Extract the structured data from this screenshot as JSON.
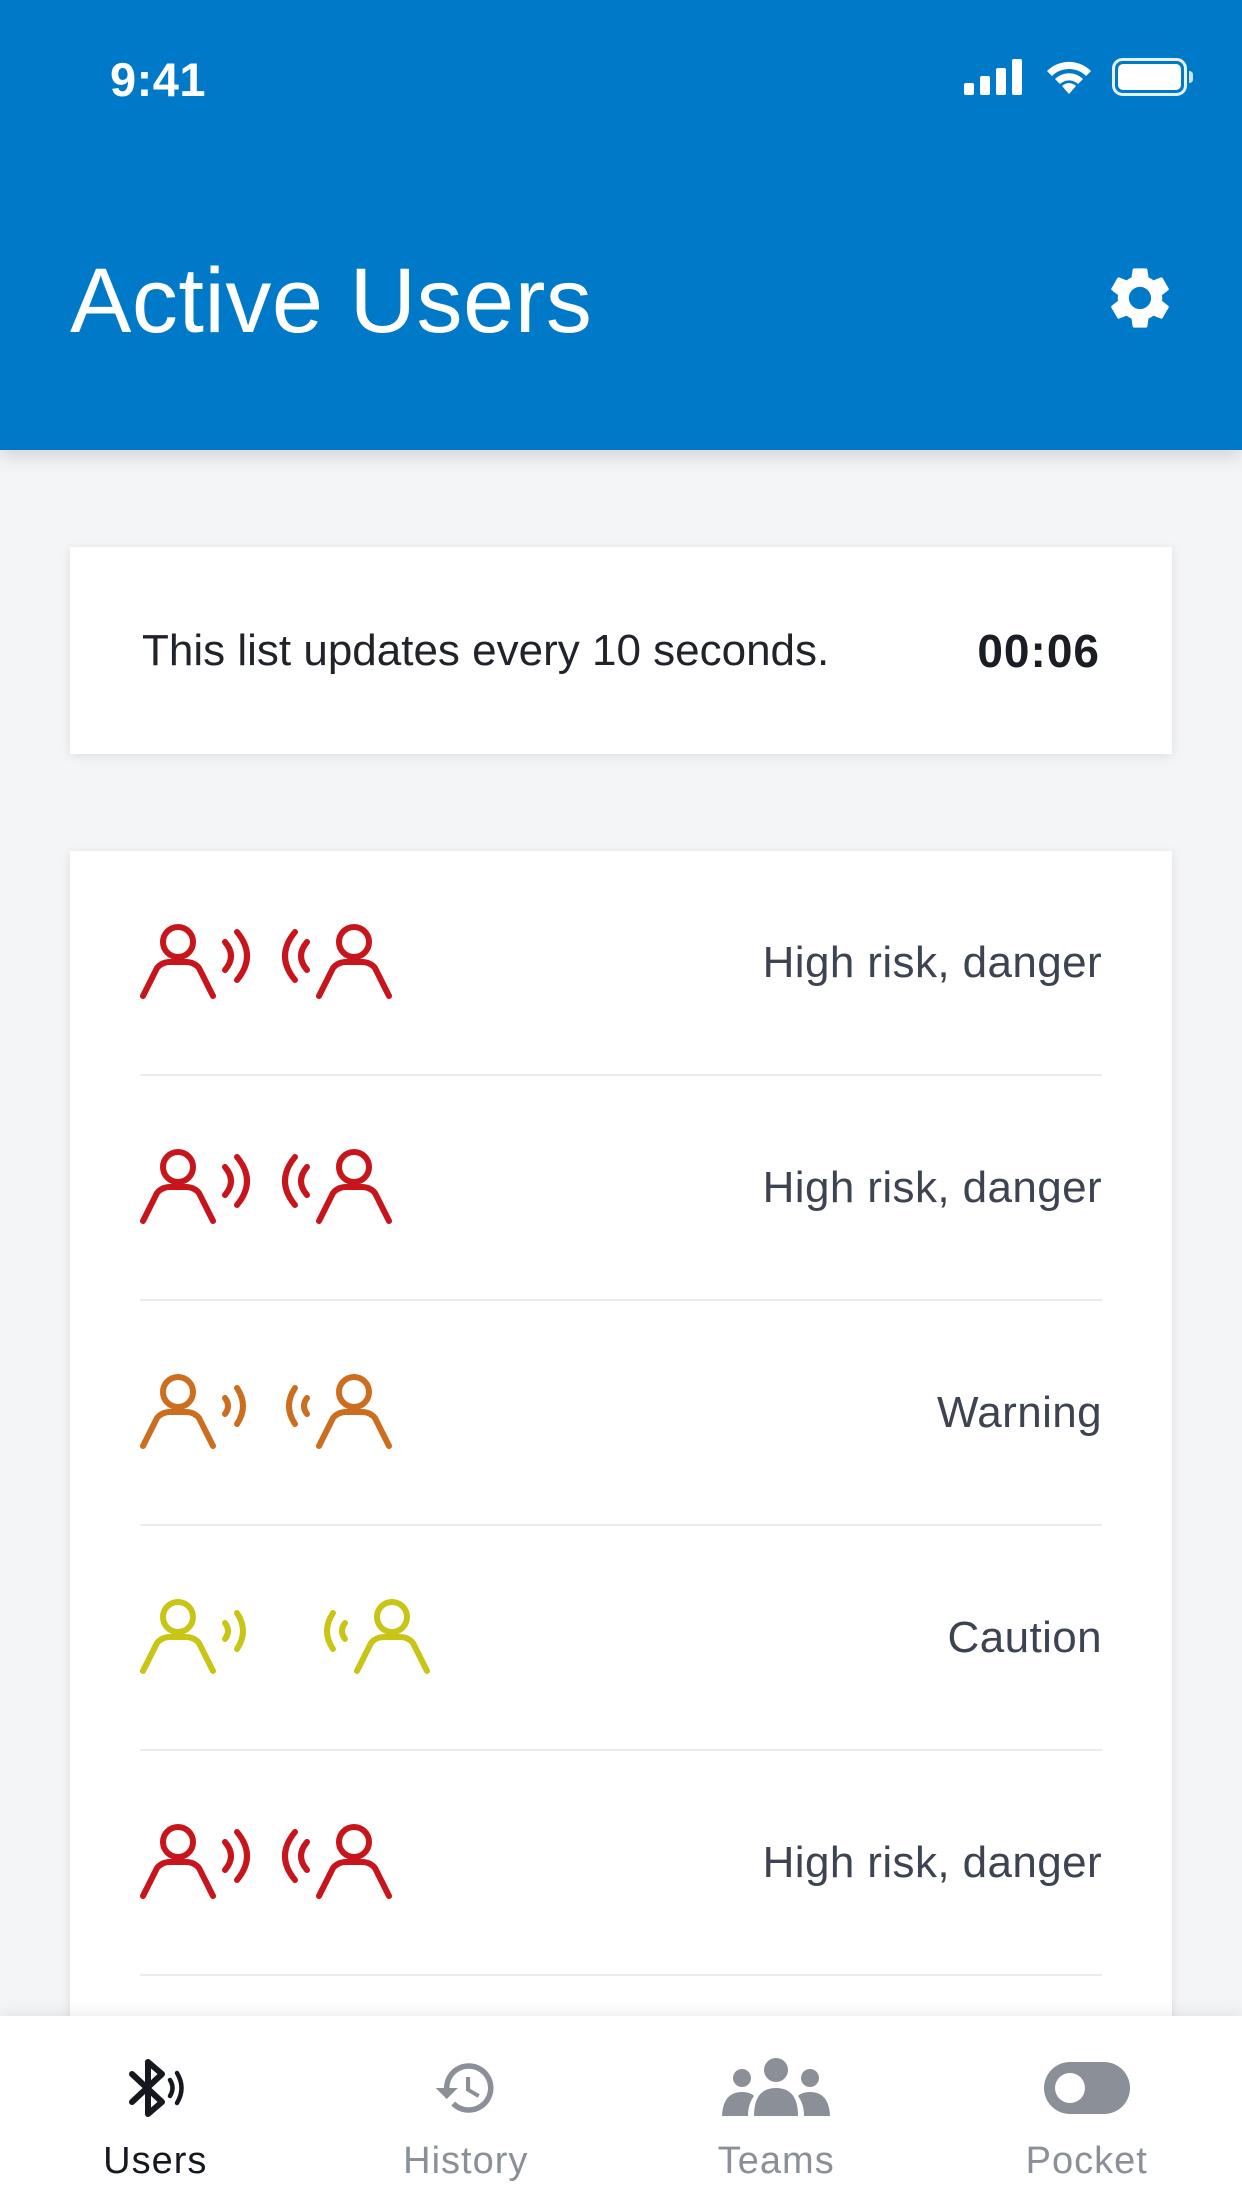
{
  "status_bar": {
    "time": "9:41"
  },
  "header": {
    "title": "Active Users",
    "settings_icon": "gear-icon"
  },
  "info_card": {
    "text": "This list updates every 10 seconds.",
    "countdown": "00:06"
  },
  "proximity_list": {
    "items": [
      {
        "label": "High risk, danger",
        "level": "high",
        "color": "#c8141b",
        "icon": "proximity-high-icon"
      },
      {
        "label": "High risk, danger",
        "level": "high",
        "color": "#c8141b",
        "icon": "proximity-high-icon"
      },
      {
        "label": "Warning",
        "level": "warning",
        "color": "#cc6e1f",
        "icon": "proximity-warning-icon"
      },
      {
        "label": "Caution",
        "level": "caution",
        "color": "#c9c516",
        "icon": "proximity-caution-icon"
      },
      {
        "label": "High risk, danger",
        "level": "high",
        "color": "#c8141b",
        "icon": "proximity-high-icon"
      }
    ]
  },
  "bottom_nav": {
    "active_color": "#15181f",
    "inactive_color": "#8a8f98",
    "items": [
      {
        "label": "Users",
        "icon": "bluetooth-icon",
        "active": true
      },
      {
        "label": "History",
        "icon": "history-icon",
        "active": false
      },
      {
        "label": "Teams",
        "icon": "teams-icon",
        "active": false
      },
      {
        "label": "Pocket",
        "icon": "toggle-icon",
        "active": false
      }
    ]
  },
  "colors": {
    "header_bg": "#0079c8",
    "page_bg": "#f4f5f7"
  }
}
